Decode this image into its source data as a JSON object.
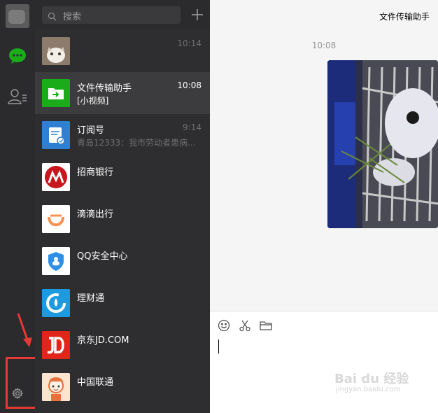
{
  "search": {
    "placeholder": "搜索"
  },
  "chats": [
    {
      "name": "",
      "time": "10:14",
      "preview": ""
    },
    {
      "name": "文件传输助手",
      "time": "10:08",
      "preview": "[小视频]",
      "active": true
    },
    {
      "name": "订阅号",
      "time": "9:14",
      "preview": "青岛12333：我市劳动者患病..."
    },
    {
      "name": "招商银行",
      "time": "",
      "preview": ""
    },
    {
      "name": "滴滴出行",
      "time": "",
      "preview": ""
    },
    {
      "name": "QQ安全中心",
      "time": "",
      "preview": ""
    },
    {
      "name": "理财通",
      "time": "",
      "preview": ""
    },
    {
      "name": "京东JD.COM",
      "time": "",
      "preview": ""
    },
    {
      "name": "中国联通",
      "time": "",
      "preview": ""
    }
  ],
  "main": {
    "title": "文件传输助手",
    "message_time": "10:08"
  },
  "icons": {
    "rail": [
      "user-avatar",
      "chat-icon",
      "contacts-icon",
      "settings-icon"
    ],
    "composer": [
      "emoji-icon",
      "scissors-icon",
      "folder-icon"
    ]
  },
  "colors": {
    "wechat_green": "#1aad19",
    "rail_bg": "#2b2b2d",
    "list_bg": "#2e2e30",
    "active_bg": "#3c3c3e",
    "annotation_red": "#e53935"
  },
  "watermark": {
    "text": "Bai du 经验",
    "sub": "jingyan.baidu.com"
  }
}
